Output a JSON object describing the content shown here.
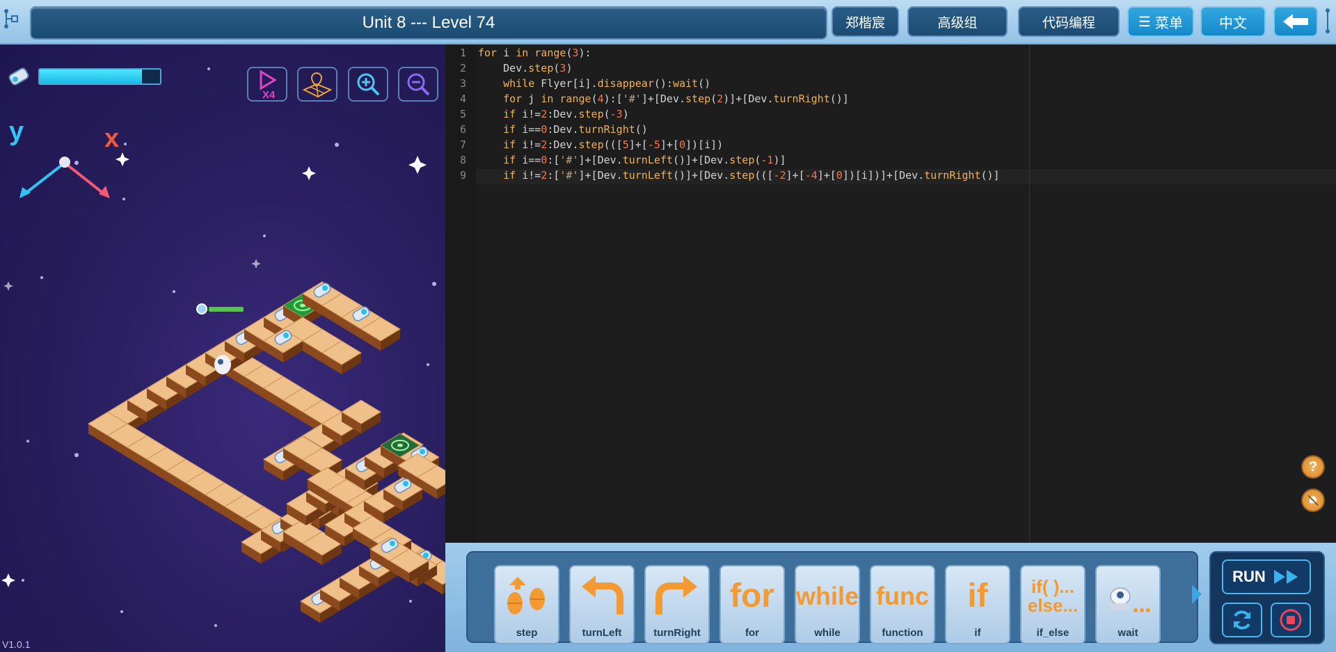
{
  "header": {
    "title": "Unit 8 --- Level 74",
    "user_name": "郑楷宸",
    "group": "高级组",
    "mode": "代码编程",
    "menu_label": "菜单",
    "language": "中文"
  },
  "game": {
    "version": "V1.0.1",
    "energy_fraction": 0.85,
    "axis_y": "y",
    "axis_x": "x",
    "speed_label": "X4"
  },
  "editor": {
    "line_numbers": [
      "1",
      "2",
      "3",
      "4",
      "5",
      "6",
      "7",
      "8",
      "9"
    ],
    "lines": [
      "for i in range(3):",
      "    Dev.step(3)",
      "    while Flyer[i].disappear():wait()",
      "    for j in range(4):['#']+[Dev.step(2)]+[Dev.turnRight()]",
      "    if i!=2:Dev.step(-3)",
      "    if i==0:Dev.turnRight()",
      "    if i!=2:Dev.step(([5]+[-5]+[0])[i])",
      "    if i==0:['#']+[Dev.turnLeft()]+[Dev.step(-1)]",
      "    if i!=2:['#']+[Dev.turnLeft()]+[Dev.step(([-2]+[-4]+[0])[i])]+[Dev.turnRight()]"
    ]
  },
  "blocks": [
    {
      "label": "step",
      "glyph": "step-icon"
    },
    {
      "label": "turnLeft",
      "glyph": "turn-left-icon"
    },
    {
      "label": "turnRight",
      "glyph": "turn-right-icon"
    },
    {
      "label": "for",
      "glyph": "for"
    },
    {
      "label": "while",
      "glyph": "while"
    },
    {
      "label": "function",
      "glyph": "func"
    },
    {
      "label": "if",
      "glyph": "if"
    },
    {
      "label": "if_else",
      "glyph": "if( )...\nelse..."
    },
    {
      "label": "wait",
      "glyph": "wait-icon"
    }
  ],
  "controls": {
    "run_label": "RUN"
  },
  "colors": {
    "accent": "#1688c8",
    "block_orange": "#f39a32",
    "energy": "#17b9e6"
  }
}
